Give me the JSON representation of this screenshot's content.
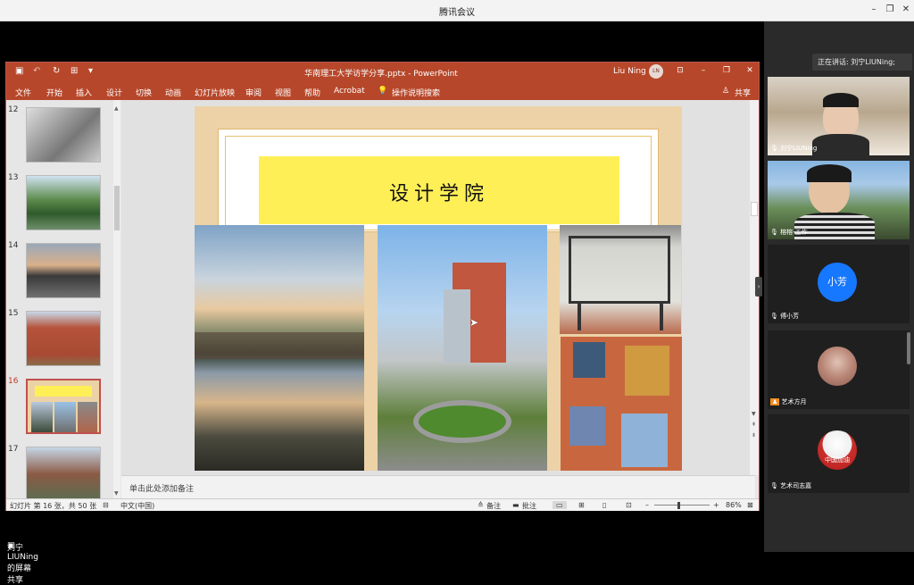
{
  "window": {
    "title": "腾讯会议"
  },
  "ppt": {
    "title": "华南理工大学访学分享.pptx - PowerPoint",
    "user": "Liu Ning",
    "user_initials": "LN",
    "menu": [
      "文件",
      "开始",
      "插入",
      "设计",
      "切换",
      "动画",
      "幻灯片放映",
      "审阅",
      "视图",
      "帮助",
      "Acrobat",
      "操作说明搜索"
    ],
    "share_label": "共享",
    "thumb_numbers": [
      "12",
      "13",
      "14",
      "15",
      "16",
      "17"
    ],
    "slide_title": "设计学院",
    "notes_placeholder": "单击此处添加备注",
    "status": {
      "slide_info": "幻灯片 第 16 张，共 50 张",
      "language": "中文(中国)",
      "notes_btn": "备注",
      "comments_btn": "批注",
      "zoom": "86%"
    }
  },
  "meeting": {
    "speaking": "正在讲话: 刘宁LIUNing;",
    "participants": [
      {
        "name": "刘宁LIUNing"
      },
      {
        "name": "榕榕-工作"
      },
      {
        "name": "傅小芳",
        "avatar_text": "小芳"
      },
      {
        "name": "艺术方月"
      },
      {
        "name": "艺术司志嘉",
        "avatar_text": "中国加油"
      }
    ],
    "share_caption": "刘宁LIUNing的屏幕共享"
  },
  "colors": {
    "ppt_accent": "#b7472a",
    "banner": "#ffef57",
    "slide_bg": "#ecd2a6",
    "avatar_blue": "#1677ff"
  }
}
